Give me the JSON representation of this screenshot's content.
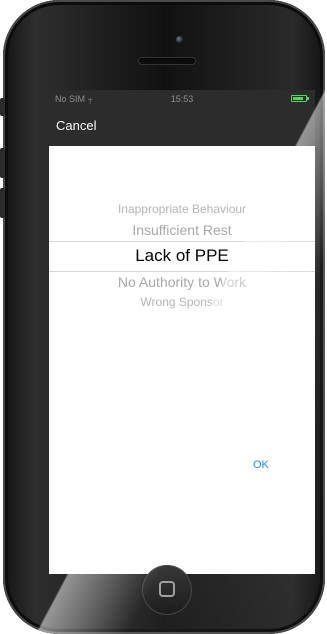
{
  "status_bar": {
    "carrier": "No SIM ⨥",
    "time": "15:53",
    "battery_level": 0.85,
    "battery_color": "#4cd964"
  },
  "toolbar": {
    "cancel_label": "Cancel"
  },
  "picker": {
    "items": [
      "Inappropriate Behaviour",
      "Insufficient Rest",
      "Lack of PPE",
      "No Authority to Work",
      "Wrong Sponsor"
    ],
    "selected": "Lack of PPE"
  },
  "actions": {
    "ok_label": "OK",
    "ok_color": "#1a82fb"
  },
  "icons": {
    "camera": "camera-icon",
    "speaker": "speaker-grille-icon",
    "home": "home-square-icon",
    "wifi": "wifi-icon"
  }
}
